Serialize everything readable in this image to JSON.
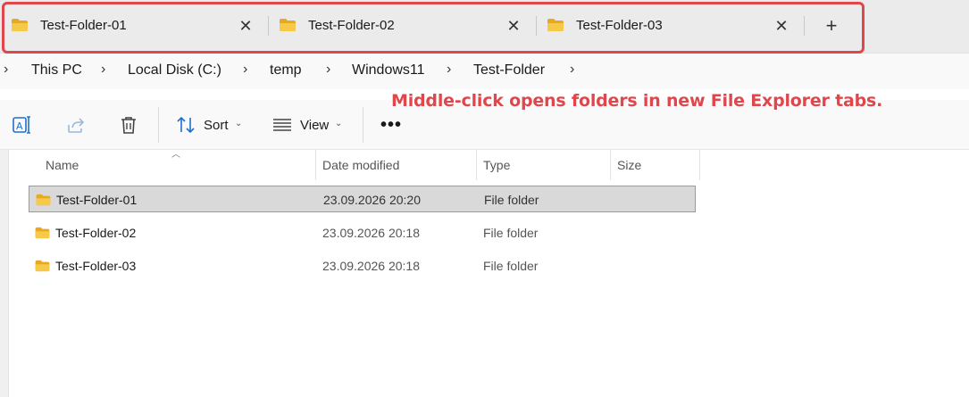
{
  "tabs": [
    {
      "label": "Test-Folder-01",
      "close": "✕"
    },
    {
      "label": "Test-Folder-02",
      "close": "✕"
    },
    {
      "label": "Test-Folder-03",
      "close": "✕"
    }
  ],
  "new_tab_label": "+",
  "breadcrumb": {
    "separator": "›",
    "items": [
      "This PC",
      "Local Disk (C:)",
      "temp",
      "Windows11",
      "Test-Folder"
    ]
  },
  "annotation": "Middle-click opens folders in new File Explorer tabs.",
  "commandbar": {
    "sort_label": "Sort",
    "view_label": "View",
    "caret": "⌄",
    "more": "•••"
  },
  "columns": {
    "name": "Name",
    "date": "Date modified",
    "type": "Type",
    "size": "Size"
  },
  "files": [
    {
      "name": "Test-Folder-01",
      "date": "23.09.2026 20:20",
      "type": "File folder",
      "selected": true
    },
    {
      "name": "Test-Folder-02",
      "date": "23.09.2026 20:18",
      "type": "File folder",
      "selected": false
    },
    {
      "name": "Test-Folder-03",
      "date": "23.09.2026 20:18",
      "type": "File folder",
      "selected": false
    }
  ],
  "colors": {
    "highlight": "#e0474c",
    "folder": "#f5c542",
    "selection": "#d9d9d9"
  }
}
